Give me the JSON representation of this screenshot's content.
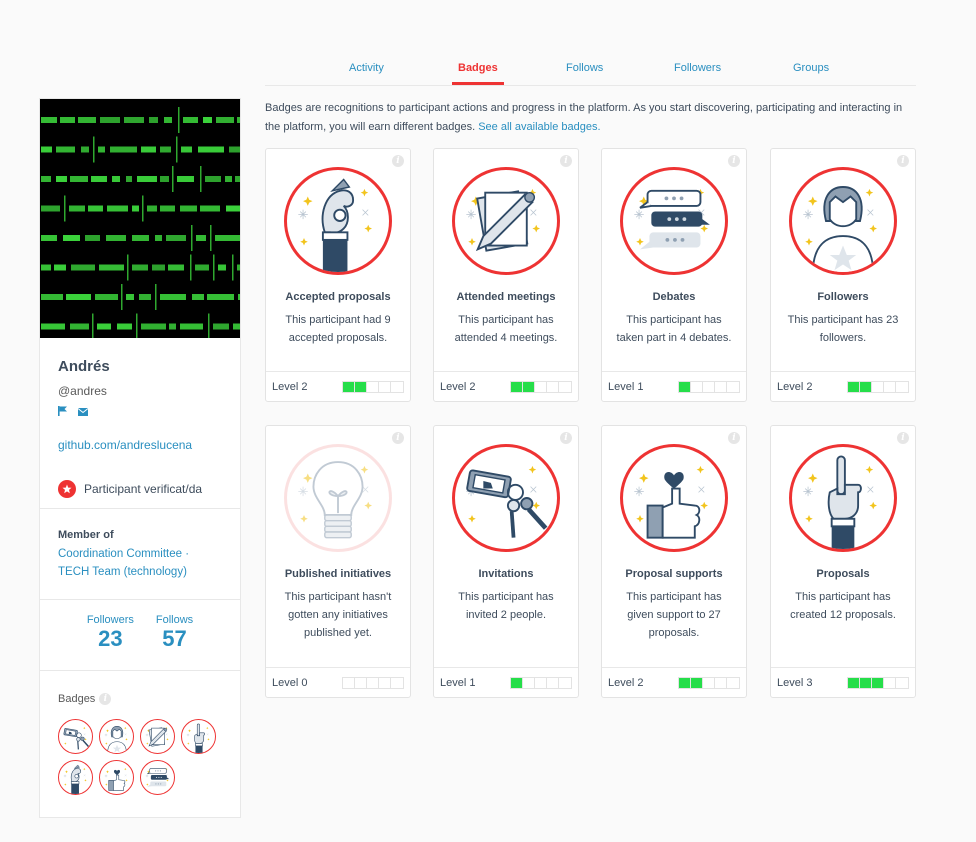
{
  "tabs": [
    {
      "label": "Activity",
      "active": false
    },
    {
      "label": "Badges",
      "active": true
    },
    {
      "label": "Follows",
      "active": false
    },
    {
      "label": "Followers",
      "active": false
    },
    {
      "label": "Groups",
      "active": false
    }
  ],
  "intro": {
    "text": "Badges are recognitions to participant actions and progress in the platform. As you start discovering, participating and interacting in the platform, you will earn different badges. ",
    "link": "See all available badges."
  },
  "profile": {
    "name": "Andrés",
    "nickname": "@andres",
    "actions": [
      "flag-icon",
      "mail-icon"
    ],
    "link": "github.com/andreslucena",
    "verified_label": "Participant verificat/da",
    "member_of_title": "Member of",
    "member_of_groups": "Coordination Committee · TECH Team (technology)",
    "stats": [
      {
        "label": "Followers",
        "value": "23"
      },
      {
        "label": "Follows",
        "value": "57"
      }
    ],
    "badges_title": "Badges",
    "mini_badges": [
      "invitations",
      "followers",
      "attended-meetings",
      "proposals",
      "accepted-proposals",
      "proposal-supports",
      "debates"
    ]
  },
  "badges": [
    {
      "id": "accepted-proposals",
      "title": "Accepted proposals",
      "description": "This participant had 9 accepted proposals.",
      "level_label": "Level 2",
      "level": 2,
      "max_level": 5
    },
    {
      "id": "attended-meetings",
      "title": "Attended meetings",
      "description": "This participant has attended 4 meetings.",
      "level_label": "Level 2",
      "level": 2,
      "max_level": 5
    },
    {
      "id": "debates",
      "title": "Debates",
      "description": "This participant has taken part in 4 debates.",
      "level_label": "Level 1",
      "level": 1,
      "max_level": 5
    },
    {
      "id": "followers",
      "title": "Followers",
      "description": "This participant has 23 followers.",
      "level_label": "Level 2",
      "level": 2,
      "max_level": 5
    },
    {
      "id": "published-initiatives",
      "title": "Published initiatives",
      "description": "This participant hasn't gotten any initiatives published yet.",
      "level_label": "Level 0",
      "level": 0,
      "max_level": 5
    },
    {
      "id": "invitations",
      "title": "Invitations",
      "description": "This participant has invited 2 people.",
      "level_label": "Level 1",
      "level": 1,
      "max_level": 5
    },
    {
      "id": "proposal-supports",
      "title": "Proposal supports",
      "description": "This participant has given support to 27 proposals.",
      "level_label": "Level 2",
      "level": 2,
      "max_level": 5
    },
    {
      "id": "proposals",
      "title": "Proposals",
      "description": "This participant has created 12 proposals.",
      "level_label": "Level 3",
      "level": 3,
      "max_level": 5
    }
  ],
  "colors": {
    "accent": "#e33333",
    "link": "#2a8fc0",
    "level_on": "#26de4a"
  }
}
